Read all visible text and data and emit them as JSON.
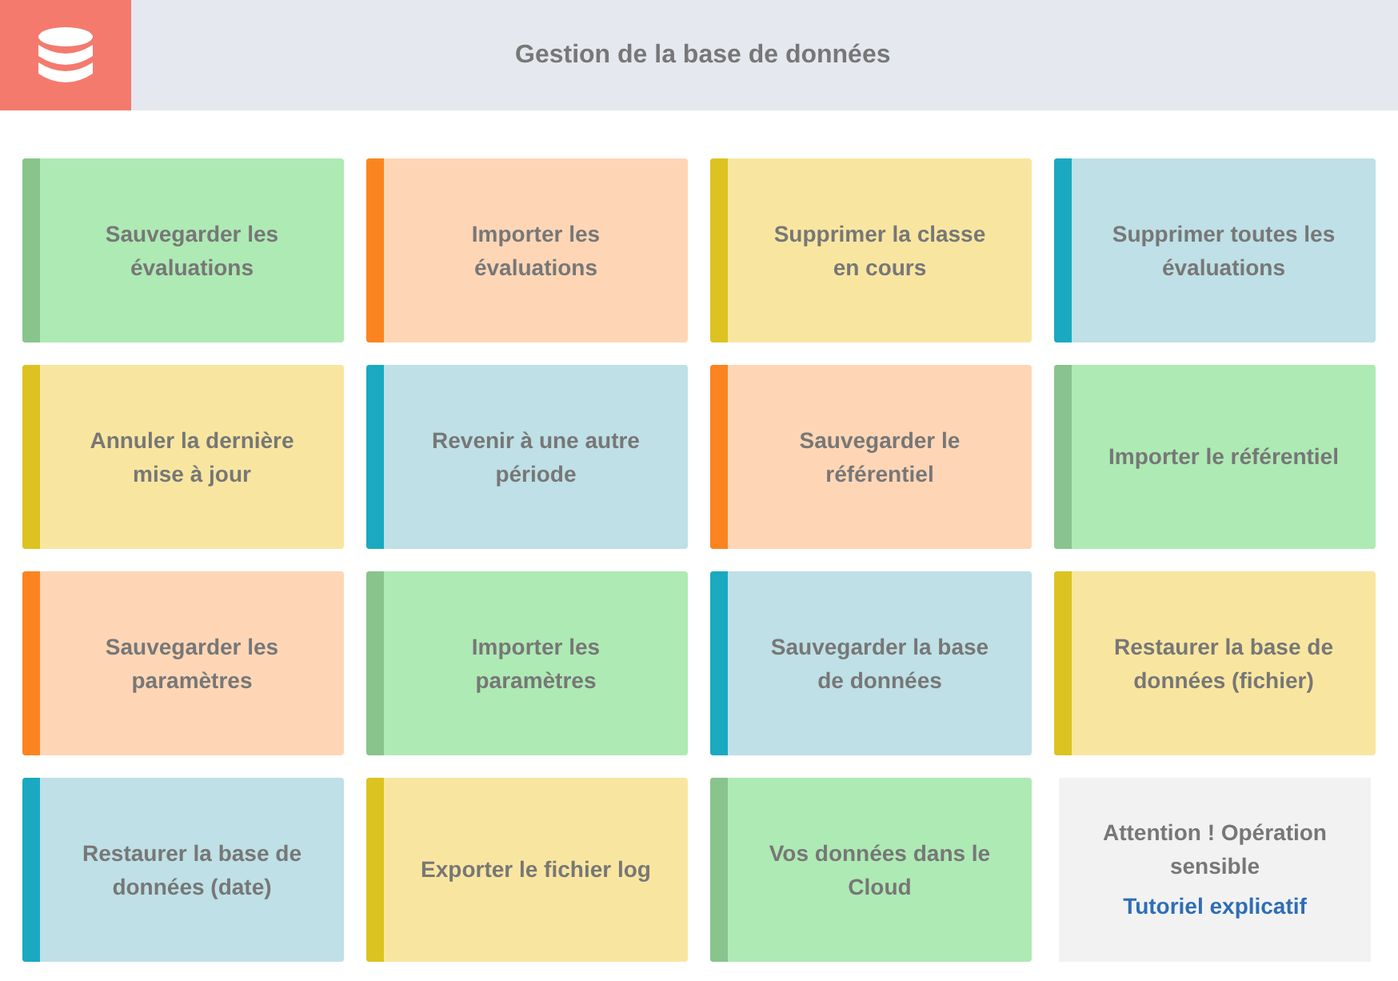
{
  "header": {
    "title": "Gestion de la base de données"
  },
  "tiles": [
    {
      "kind": "action",
      "label": "Sauvegarder les évaluations",
      "color": "#88c48c"
    },
    {
      "kind": "action",
      "label": "Importer les évaluations",
      "color": "#fb8420"
    },
    {
      "kind": "action",
      "label": "Supprimer la classe en cours",
      "color": "#dcc321"
    },
    {
      "kind": "action",
      "label": "Supprimer toutes les évaluations",
      "color": "#1aa9c0"
    },
    {
      "kind": "action",
      "label": "Annuler la dernière mise à jour",
      "color": "#dcc321"
    },
    {
      "kind": "action",
      "label": "Revenir à une autre période",
      "color": "#1aa9c0"
    },
    {
      "kind": "action",
      "label": "Sauvegarder le référentiel",
      "color": "#fb8420"
    },
    {
      "kind": "action",
      "label": "Importer le référentiel",
      "color": "#88c48c"
    },
    {
      "kind": "action",
      "label": "Sauvegarder les paramètres",
      "color": "#fb8420"
    },
    {
      "kind": "action",
      "label": "Importer les paramètres",
      "color": "#88c48c"
    },
    {
      "kind": "action",
      "label": "Sauvegarder la base de données",
      "color": "#1aa9c0"
    },
    {
      "kind": "action",
      "label": "Restaurer la base de données (fichier)",
      "color": "#dcc321"
    },
    {
      "kind": "action",
      "label": "Restaurer la base de données (date)",
      "color": "#1aa9c0"
    },
    {
      "kind": "action",
      "label": "Exporter le fichier log",
      "color": "#dcc321"
    },
    {
      "kind": "action",
      "label": "Vos données dans le Cloud",
      "color": "#88c48c"
    },
    {
      "kind": "notice",
      "label": "Attention ! Opération sensible",
      "link": "Tutoriel explicatif"
    }
  ]
}
